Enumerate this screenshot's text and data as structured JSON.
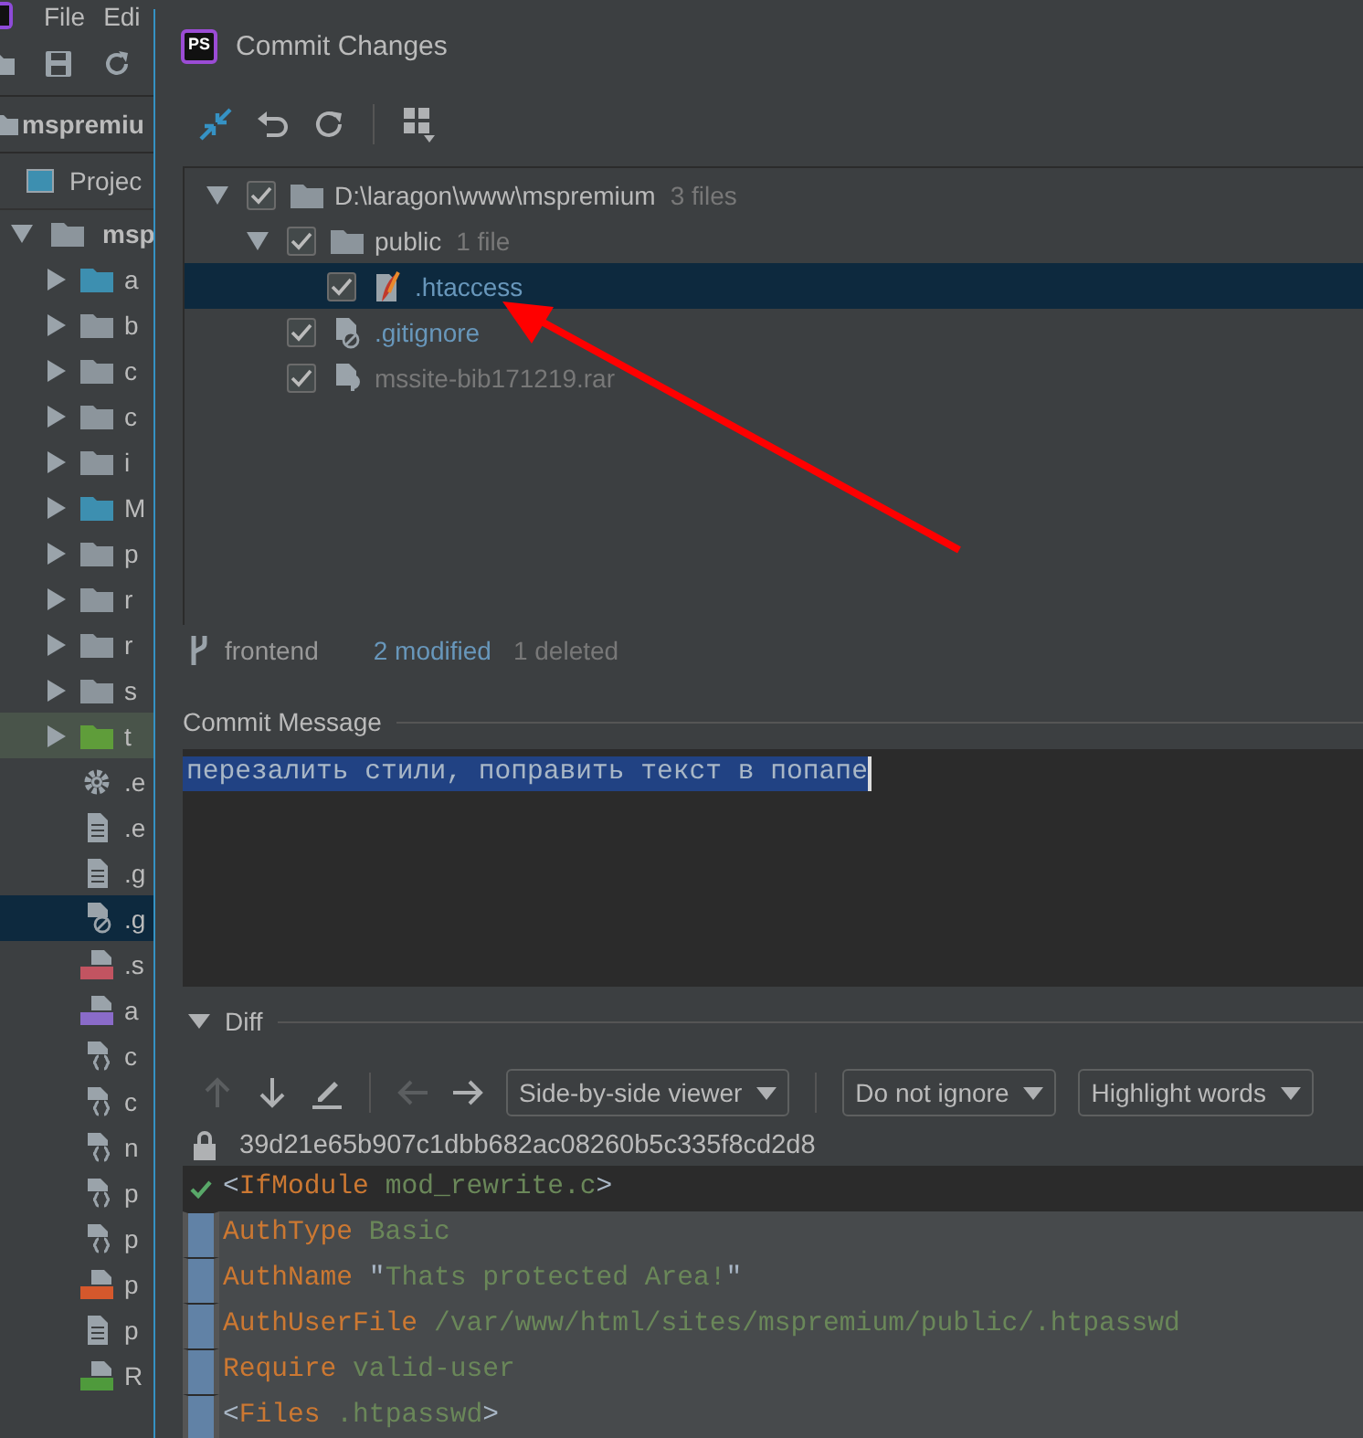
{
  "ide": {
    "menu": [
      "File",
      "Edi"
    ],
    "project_title": "mspremiu",
    "project_tab": "Projec",
    "root_name": "msp",
    "items": [
      {
        "kind": "folder-blue",
        "label": "a",
        "selected": false
      },
      {
        "kind": "folder",
        "label": "b",
        "selected": false
      },
      {
        "kind": "folder",
        "label": "c",
        "selected": false
      },
      {
        "kind": "folder",
        "label": "c",
        "selected": false
      },
      {
        "kind": "folder",
        "label": "i",
        "selected": false
      },
      {
        "kind": "folder-blue",
        "label": "M",
        "selected": false
      },
      {
        "kind": "folder",
        "label": "p",
        "selected": false
      },
      {
        "kind": "folder",
        "label": "r",
        "selected": false
      },
      {
        "kind": "folder",
        "label": "r",
        "selected": false
      },
      {
        "kind": "folder",
        "label": "s",
        "selected": false
      },
      {
        "kind": "folder-green",
        "label": "t",
        "selected": false
      },
      {
        "kind": "gear",
        "label": ".e",
        "selected": false
      },
      {
        "kind": "doc",
        "label": ".e",
        "selected": false
      },
      {
        "kind": "doc",
        "label": ".g",
        "selected": false
      },
      {
        "kind": "ignore",
        "label": ".g",
        "selected": true
      },
      {
        "kind": "yml",
        "label": ".s",
        "selected": false
      },
      {
        "kind": "php",
        "label": "a",
        "selected": false
      },
      {
        "kind": "json",
        "label": "c",
        "selected": false
      },
      {
        "kind": "json",
        "label": "c",
        "selected": false
      },
      {
        "kind": "json",
        "label": "n",
        "selected": false
      },
      {
        "kind": "json",
        "label": "p",
        "selected": false
      },
      {
        "kind": "json",
        "label": "p",
        "selected": false
      },
      {
        "kind": "html",
        "label": "p",
        "selected": false
      },
      {
        "kind": "doc",
        "label": "p",
        "selected": false
      },
      {
        "kind": "h",
        "label": "R",
        "selected": false
      }
    ]
  },
  "dialog": {
    "logo": "PS",
    "title": "Commit Changes",
    "toolbar": [
      {
        "kind": "collapse"
      },
      {
        "kind": "undo"
      },
      {
        "kind": "refresh"
      },
      {
        "kind": "group"
      }
    ],
    "tree": [
      {
        "kind": "folder",
        "name": "D:\\laragon\\www\\mspremium",
        "count": "3 files",
        "color": "#bbbbbb",
        "checked": true,
        "expanded": true,
        "selected": false,
        "children": [
          {
            "kind": "folder",
            "name": "public",
            "count": "1 file",
            "color": "#bbbbbb",
            "checked": true,
            "expanded": true,
            "selected": false,
            "children": [
              {
                "kind": "apache",
                "name": ".htaccess",
                "color": "#6897bb",
                "checked": true,
                "selected": true
              }
            ]
          },
          {
            "kind": "ignore",
            "name": ".gitignore",
            "color": "#6897bb",
            "checked": true,
            "selected": false
          },
          {
            "kind": "unknown",
            "name": "mssite-bib171219.rar",
            "color": "#787878",
            "checked": true,
            "selected": false
          }
        ]
      }
    ],
    "status": {
      "branch": "frontend",
      "counts": [
        {
          "kind": "modified",
          "text": "2 modified"
        },
        {
          "kind": "deleted",
          "text": "1 deleted"
        }
      ]
    },
    "commit_label": "Commit Message",
    "commit_message": "перезалить стили, поправить текст в попапе",
    "diff": {
      "label": "Diff",
      "expanded": true,
      "buttons": [
        {
          "kind": "up",
          "disabled": true
        },
        {
          "kind": "down",
          "disabled": false
        },
        {
          "kind": "edit",
          "disabled": false
        },
        {
          "kind": "left",
          "disabled": true
        },
        {
          "kind": "right",
          "disabled": false
        }
      ],
      "dropdowns": [
        "Side-by-side viewer",
        "Do not ignore",
        "Highlight words"
      ],
      "hash": "39d21e65b907c1dbb682ac08260b5c335f8cd2d8",
      "lines": [
        {
          "changed": false,
          "tokens": [
            {
              "kind": "punct",
              "text": "<"
            },
            {
              "kind": "key",
              "text": "IfModule"
            },
            {
              "kind": "value",
              "text": " mod_rewrite.c"
            },
            {
              "kind": "punct",
              "text": ">"
            }
          ]
        },
        {
          "changed": true,
          "tokens": [
            {
              "kind": "key",
              "text": "AuthType"
            },
            {
              "kind": "value",
              "text": " Basic"
            }
          ]
        },
        {
          "changed": true,
          "tokens": [
            {
              "kind": "key",
              "text": "AuthName"
            },
            {
              "kind": "punct",
              "text": " \""
            },
            {
              "kind": "value",
              "text": "Thats protected Area!"
            },
            {
              "kind": "punct",
              "text": "\""
            }
          ]
        },
        {
          "changed": true,
          "tokens": [
            {
              "kind": "key",
              "text": "AuthUserFile"
            },
            {
              "kind": "value",
              "text": " /var/www/html/sites/mspremium/public/.htpasswd"
            }
          ]
        },
        {
          "changed": true,
          "tokens": [
            {
              "kind": "key",
              "text": "Require"
            },
            {
              "kind": "value",
              "text": " valid-user"
            }
          ]
        },
        {
          "changed": true,
          "tokens": [
            {
              "kind": "punct",
              "text": "<"
            },
            {
              "kind": "key",
              "text": "Files"
            },
            {
              "kind": "value",
              "text": " .htpasswd"
            },
            {
              "kind": "punct",
              "text": ">"
            }
          ]
        }
      ]
    }
  }
}
